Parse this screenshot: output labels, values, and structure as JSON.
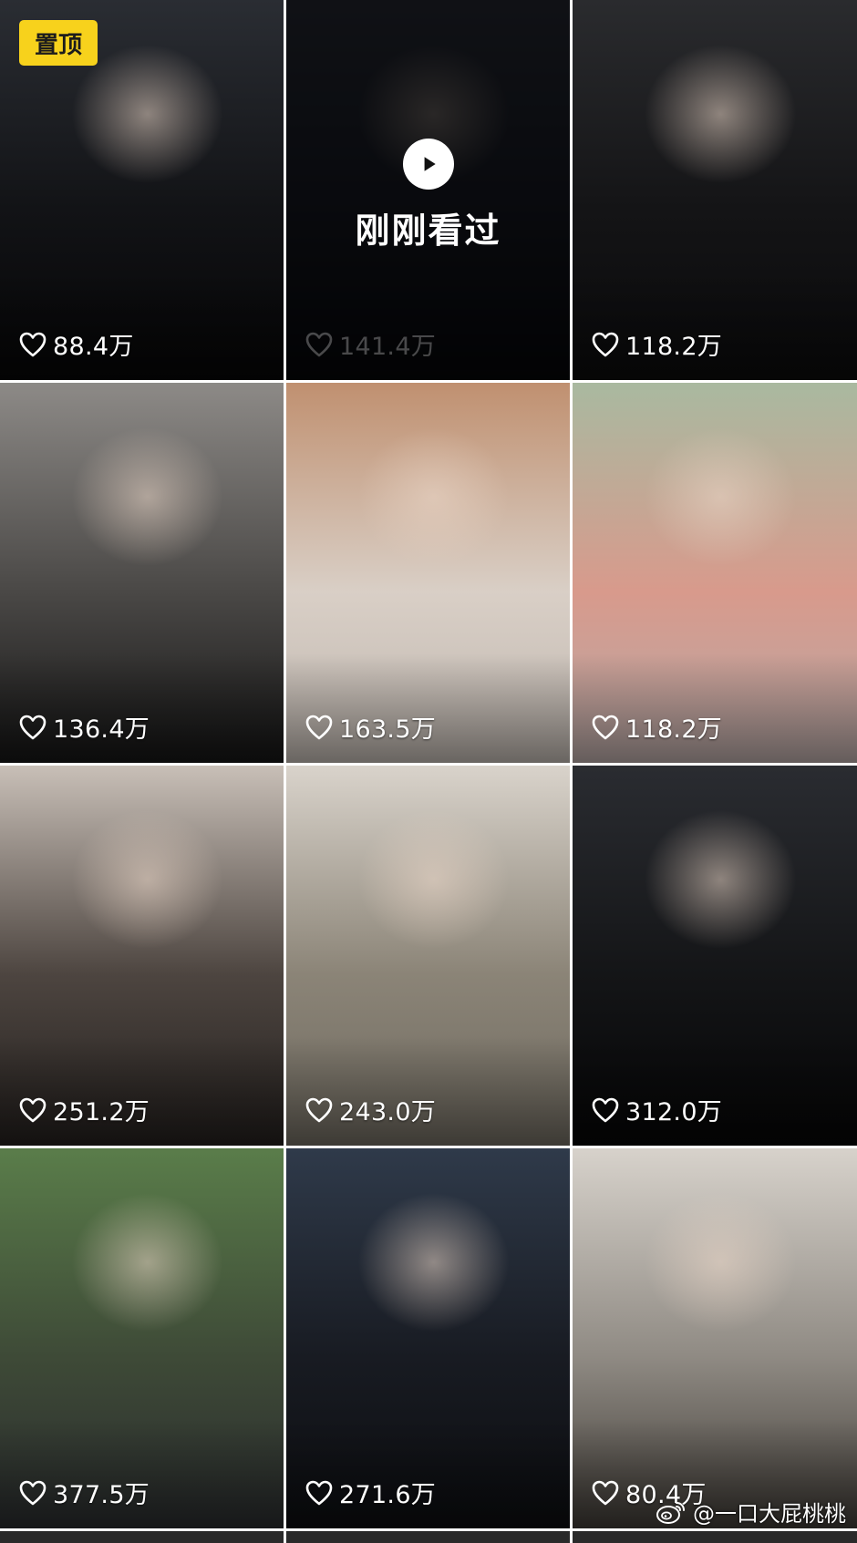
{
  "pinned_badge": "置顶",
  "recently_watched_label": "刚刚看过",
  "watermark": "@一口大屁桃桃",
  "tiles": [
    {
      "likes": "88.4万",
      "colors": [
        "#2a2d33",
        "#121316",
        "#050506"
      ]
    },
    {
      "likes": "141.4万",
      "colors": [
        "#3a3f4e",
        "#202431",
        "#0a0b10"
      ]
    },
    {
      "likes": "118.2万",
      "colors": [
        "#2a2b2e",
        "#141416",
        "#0a0a0b"
      ]
    },
    {
      "likes": "136.4万",
      "colors": [
        "#8d8a87",
        "#4a4846",
        "#151515"
      ]
    },
    {
      "likes": "163.5万",
      "colors": [
        "#c09070",
        "#d9cfc6",
        "#bfb7b0"
      ]
    },
    {
      "likes": "118.2万",
      "colors": [
        "#a9b9a0",
        "#d89a8c",
        "#b7a8a6"
      ]
    },
    {
      "likes": "251.2万",
      "colors": [
        "#c8bfb7",
        "#4d4540",
        "#231f1d"
      ]
    },
    {
      "likes": "243.0万",
      "colors": [
        "#d9d3cb",
        "#8b8477",
        "#6f6a60"
      ]
    },
    {
      "likes": "312.0万",
      "colors": [
        "#2a2c31",
        "#141517",
        "#050506"
      ]
    },
    {
      "likes": "377.5万",
      "colors": [
        "#5a7d4a",
        "#3e4a37",
        "#2a2c2e"
      ]
    },
    {
      "likes": "271.6万",
      "colors": [
        "#2f3a4a",
        "#181b22",
        "#0c0d10"
      ]
    },
    {
      "likes": "80.4万",
      "colors": [
        "#d7d2cb",
        "#8f8a83",
        "#3e3a35"
      ]
    }
  ]
}
